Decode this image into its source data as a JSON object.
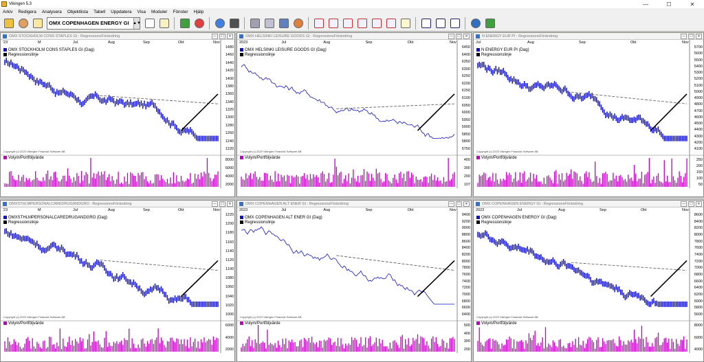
{
  "app": {
    "title": "Vikingen 5.3"
  },
  "window_controls": {
    "minimize": "—",
    "maximize": "☐",
    "close": "✕"
  },
  "menu": [
    "Arkiv",
    "Redigera",
    "Analysera",
    "Objektlista",
    "Tabell",
    "Uppdatera",
    "Visa",
    "Moduler",
    "Fönster",
    "Hjälp"
  ],
  "toolbar": {
    "selected_object": "OMX COPENHAGEN ENERGY GI"
  },
  "caption_suffix": " : RegressionsFörändring",
  "legend_regression": "Regressionslinje",
  "volume_label": "Volym/Portföljvärde",
  "copyright": "Copyright (c) 2023 Vikingen Financial Software AB",
  "months": [
    "2023",
    "M",
    "Jul",
    "Aug",
    "Sep",
    "Okt",
    "Nov"
  ],
  "colors": {
    "price": "#1010d0",
    "volume": "#c000c0",
    "regression": "#000000",
    "trend": "#555555"
  },
  "charts": [
    {
      "caption": "OMX STOCKHOLM CONS STAPLES GI",
      "series": "OMX STOCKHOLM CONS STAPLES GI (Dag)",
      "month_labels": [
        "'23",
        "M",
        "Jul",
        "Aug",
        "Sep",
        "Okt",
        "Nov"
      ],
      "y_ticks": [
        "1480",
        "1460",
        "1440",
        "1420",
        "1400",
        "1380",
        "1360",
        "1340",
        "1320",
        "1300",
        "1280",
        "1260",
        "1240",
        "1220"
      ],
      "vol_ticks": [
        "8000",
        "6000",
        "4000",
        "2000"
      ],
      "style": "bar"
    },
    {
      "caption": "OMX HELSINKI LEISURE GOODS GI",
      "series": "OMX HELSINKI LEISURE GOODS GI (Dag)",
      "month_labels": [
        "2023",
        "Jul",
        "Aug",
        "Sep",
        "Okt",
        "Nov"
      ],
      "y_ticks": [
        "6450",
        "6400",
        "6350",
        "6300",
        "6250",
        "6200",
        "6150",
        "6100",
        "6050",
        "6000",
        "5950",
        "5900",
        "5850",
        "5800",
        "5750"
      ],
      "vol_ticks": [
        "400",
        "300",
        "200",
        "107"
      ],
      "style": "line"
    },
    {
      "caption": "N ENERGY EUR PI",
      "series": "N ENERGY EUR PI (Dag)",
      "month_labels": [
        "Jul",
        "Aug",
        "Sep",
        "Okt",
        "Nov"
      ],
      "y_ticks": [
        "5700",
        "5600",
        "5500",
        "5400",
        "5300",
        "5200",
        "5100",
        "5000",
        "4900",
        "4800",
        "4700",
        "4600",
        "4500",
        "4400",
        "4300",
        "4200",
        "4100"
      ],
      "vol_ticks": [
        "250",
        "200",
        "150",
        "100",
        "50"
      ],
      "style": "bar"
    },
    {
      "caption": "OMXSTHLMPERSONALCAREDRUGANDGRO",
      "series": "OMXSTHLMPERSONALCAREDRUGANDGRO (Dag)",
      "month_labels": [
        "'23",
        "M",
        "Jul",
        "Aug",
        "Sep",
        "Okt",
        "Nov"
      ],
      "y_ticks": [
        "1220",
        "1200",
        "1180",
        "1160",
        "1140",
        "1120",
        "1100",
        "1080",
        "1060",
        "1040",
        "1020",
        "1000"
      ],
      "vol_ticks": [
        "6000",
        "4000",
        "2000"
      ],
      "style": "bar"
    },
    {
      "caption": "OMX COPENHAGEN ALT ENER GI",
      "series": "OMX COPENHAGEN ALT ENER GI (Dag)",
      "month_labels": [
        "2023",
        "Jul",
        "Aug",
        "Sep",
        "Okt",
        "Nov"
      ],
      "y_ticks": [
        "9400",
        "9200",
        "9000",
        "8800",
        "8600",
        "8400",
        "8200",
        "8000",
        "7800",
        "7600",
        "7400",
        "7200",
        "7000",
        "6800",
        "6600",
        "6400"
      ],
      "vol_ticks": [
        "500",
        "400",
        "300",
        "200"
      ],
      "style": "line"
    },
    {
      "caption": "OMX COPENHAGEN ENERGY GI",
      "series": "OMX COPENHAGEN ENERGY GI (Dag)",
      "month_labels": [
        "2023",
        "Jul",
        "Aug",
        "Sep",
        "Okt",
        "Nov"
      ],
      "y_ticks": [
        "8600",
        "8400",
        "8200",
        "8000",
        "7800",
        "7600",
        "7400",
        "7200",
        "7000",
        "6800",
        "6600",
        "6400",
        "6200",
        "6000",
        "5800",
        "5600"
      ],
      "vol_ticks": [
        "8000",
        "6000",
        "4000"
      ],
      "style": "bar"
    }
  ]
}
